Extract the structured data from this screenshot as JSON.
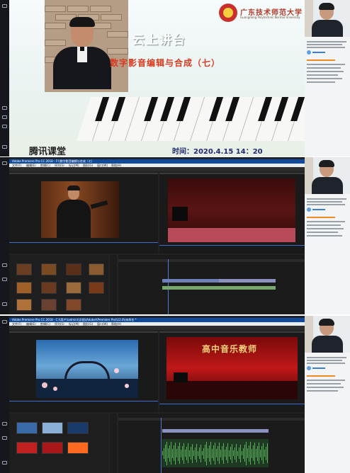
{
  "slide": {
    "title": "云上讲台",
    "subtitle": "数字影音编辑与合成（七）",
    "university_cn": "广东技术师范大学",
    "university_en": "Guangdong Polytechnic Normal University",
    "platform": "腾讯课堂",
    "time_label": "时间：",
    "time_value": "2020.4.15   14：20"
  },
  "premiere_1": {
    "title": "Adobe Premiere Pro CC 2018 - F:\\\\数字影音编辑与合成（七）",
    "menu": [
      "文件(F)",
      "编辑(E)",
      "剪辑(C)",
      "序列(S)",
      "标记(M)",
      "图形(G)",
      "窗口(W)",
      "帮助(H)"
    ]
  },
  "premiere_2": {
    "title": "Adobe Premiere Pro CC 2018 - C:\\\\用户\\\\admin\\\\文档\\\\Adobe\\\\Premiere Pro\\\\12.0\\\\未命名 *",
    "menu": [
      "文件(F)",
      "编辑(E)",
      "剪辑(C)",
      "序列(S)",
      "标记(M)",
      "图形(G)",
      "窗口(W)",
      "帮助(H)"
    ]
  },
  "stage_banner": "高中音乐教师",
  "colors": {
    "premiere_title_bar": "#0f4c9c",
    "premiere_bg": "#232323",
    "accent_orange": "#f08a24",
    "accent_blue": "#3c7ed6"
  },
  "icons": [
    "menu-icon",
    "chat-icon",
    "hand-icon",
    "settings-icon",
    "power-icon"
  ]
}
